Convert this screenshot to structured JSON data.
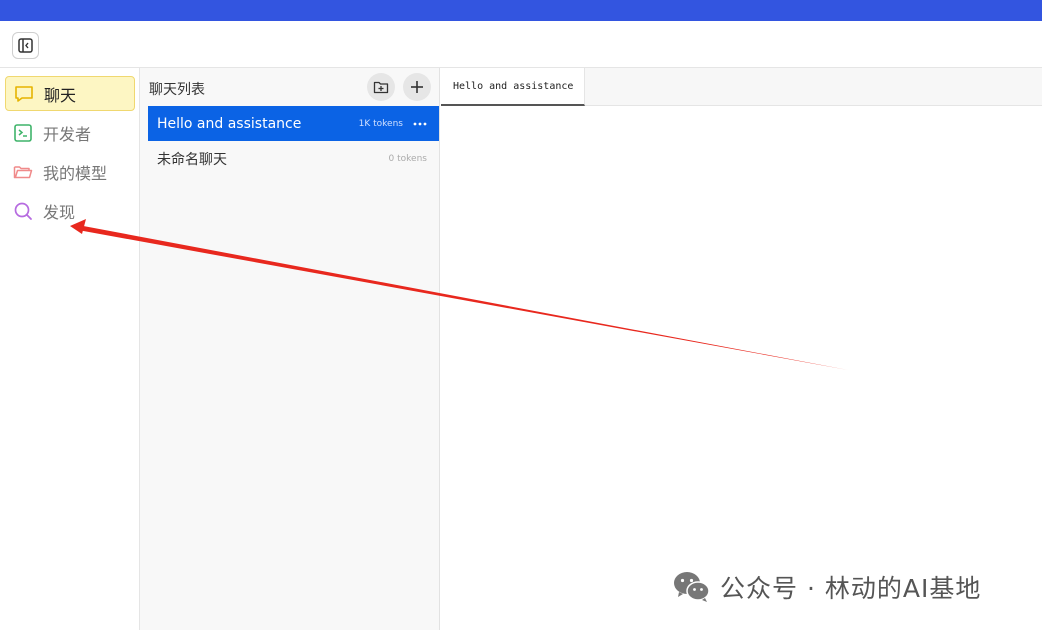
{
  "colors": {
    "topbar": "#3355e0",
    "active_nav_bg": "#fdf6c3",
    "active_chat_bg": "#0b63e5",
    "arrow": "#e8281e",
    "nav_chat_icon": "#e6b400",
    "nav_dev_icon": "#3fb46a",
    "nav_models_icon": "#f08a8a",
    "nav_discover_icon": "#b66be0"
  },
  "sidebar": {
    "items": [
      {
        "label": "聊天",
        "icon": "chat-bubble-icon"
      },
      {
        "label": "开发者",
        "icon": "terminal-icon"
      },
      {
        "label": "我的模型",
        "icon": "folder-icon"
      },
      {
        "label": "发现",
        "icon": "search-icon"
      }
    ]
  },
  "chatlist": {
    "title": "聊天列表",
    "new_folder_icon": "folder-plus-icon",
    "new_chat_icon": "plus-icon",
    "items": [
      {
        "name": "Hello and assistance",
        "tokens": "1K tokens"
      },
      {
        "name": "未命名聊天",
        "tokens": "0 tokens"
      }
    ]
  },
  "main": {
    "tabs": [
      {
        "label": "Hello and assistance"
      }
    ]
  },
  "watermark": {
    "text": "公众号 · 林动的AI基地"
  }
}
